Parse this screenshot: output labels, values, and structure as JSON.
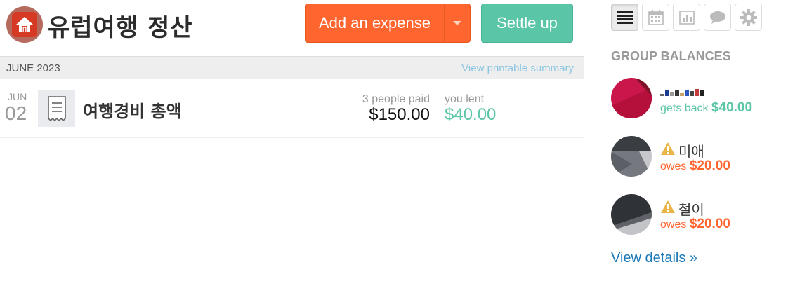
{
  "group": {
    "title": "유럽여행 정산",
    "icon": "home-icon"
  },
  "actions": {
    "add_expense": "Add an expense",
    "settle_up": "Settle up"
  },
  "month": {
    "label": "JUNE 2023",
    "printable_link": "View printable summary"
  },
  "expense": {
    "month": "JUN",
    "day": "02",
    "title": "여행경비 총액",
    "paid_label": "3 people paid",
    "paid_amount": "$150.00",
    "lent_label": "you lent",
    "lent_amount": "$40.00"
  },
  "sidebar": {
    "tabs": [
      "list-icon",
      "calendar-icon",
      "chart-icon",
      "chat-icon",
      "gear-icon"
    ],
    "heading": "GROUP BALANCES",
    "members": [
      {
        "name": "",
        "status_label": "gets back",
        "amount": "$40.00"
      },
      {
        "name": "미애",
        "status_label": "owes",
        "amount": "$20.00"
      },
      {
        "name": "철이",
        "status_label": "owes",
        "amount": "$20.00"
      }
    ],
    "view_details": "View details »"
  },
  "colors": {
    "add_button": "#ff652f",
    "settle_button": "#5bc5a7",
    "positive": "#5bc5a7",
    "negative": "#ff652f",
    "link": "#1a78b8"
  }
}
